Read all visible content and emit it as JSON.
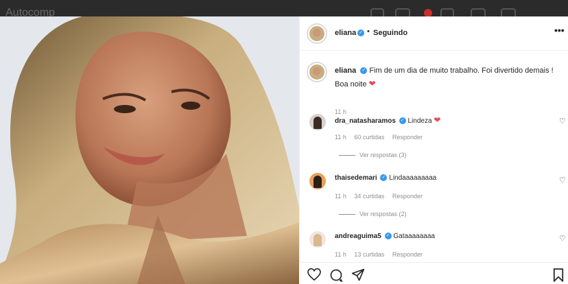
{
  "topbar": {
    "blurred_text": "Autocomp"
  },
  "post": {
    "author": {
      "username": "eliana",
      "verified": true,
      "follow_status": "Seguindo"
    },
    "caption": {
      "username": "eliana",
      "text": "Fim de um dia de muito trabalho. Foi divertido demais ! Boa noite",
      "emoji": "heart-icon",
      "time": "11 h"
    }
  },
  "comments": [
    {
      "username": "dra_natasharamos",
      "verified": true,
      "text": "Lindeza",
      "time": "11 h",
      "likes": "60 curtidas",
      "reply": "Responder",
      "view_replies": "Ver respostas (3)"
    },
    {
      "username": "thaisedemari",
      "verified": true,
      "text": "Lindaaaaaaaaa",
      "time": "11 h",
      "likes": "34 curtidas",
      "reply": "Responder",
      "view_replies": "Ver respostas (2)"
    },
    {
      "username": "andreaguima5",
      "verified": true,
      "text": "Gataaaaaaaa",
      "time": "11 h",
      "likes": "13 curtidas",
      "reply": "Responder"
    }
  ],
  "icons": {
    "more": "more-options-icon",
    "like": "heart-icon",
    "comment": "comment-icon",
    "share": "share-icon",
    "save": "bookmark-icon"
  },
  "colors": {
    "verified": "#3897f0",
    "heart": "#ed4956",
    "secondary_text": "#8e8e8e"
  }
}
